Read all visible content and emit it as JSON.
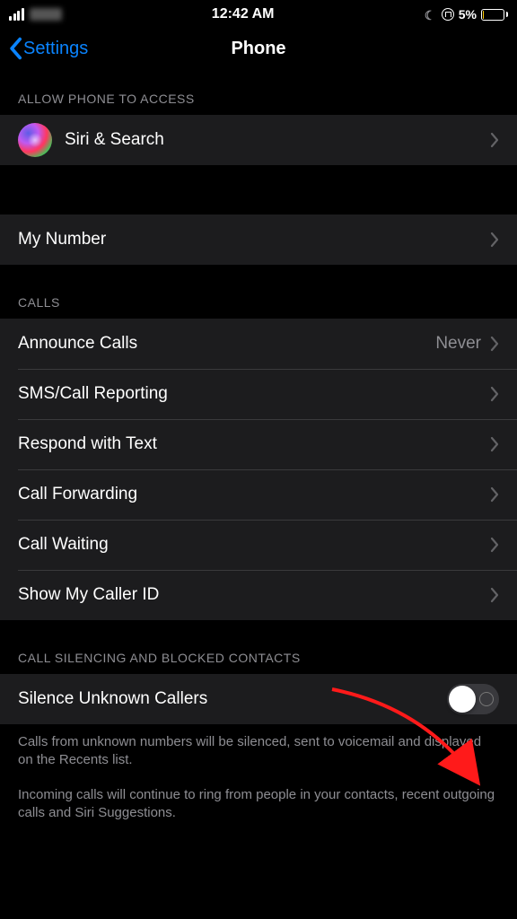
{
  "status": {
    "time": "12:42 AM",
    "battery_pct": "5%"
  },
  "nav": {
    "back_label": "Settings",
    "title": "Phone"
  },
  "section_access": {
    "header": "ALLOW PHONE TO ACCESS",
    "siri_label": "Siri & Search"
  },
  "section_number": {
    "my_number_label": "My Number"
  },
  "section_calls": {
    "header": "CALLS",
    "announce_label": "Announce Calls",
    "announce_value": "Never",
    "sms_label": "SMS/Call Reporting",
    "respond_label": "Respond with Text",
    "forwarding_label": "Call Forwarding",
    "waiting_label": "Call Waiting",
    "callerid_label": "Show My Caller ID"
  },
  "section_silence": {
    "header": "CALL SILENCING AND BLOCKED CONTACTS",
    "silence_label": "Silence Unknown Callers",
    "footer1": "Calls from unknown numbers will be silenced, sent to voicemail and displayed on the Recents list.",
    "footer2": "Incoming calls will continue to ring from people in your contacts, recent outgoing calls and Siri Suggestions."
  }
}
